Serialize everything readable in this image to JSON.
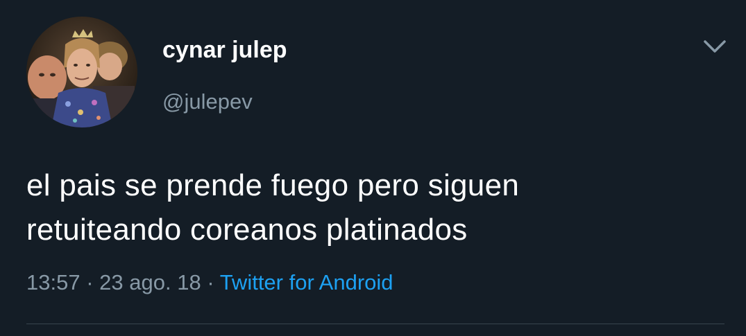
{
  "tweet": {
    "author": {
      "display_name": "cynar julep",
      "handle": "@julepev",
      "avatar_icon": "profile-photo"
    },
    "menu_icon": "chevron-down-icon",
    "text_line_1": "el pais se prende fuego pero siguen",
    "text_line_2": "retuiteando coreanos platinados",
    "time": "13:57",
    "separator": "·",
    "date": "23 ago. 18",
    "source": "Twitter for Android"
  },
  "colors": {
    "background": "#141d26",
    "text": "#ffffff",
    "muted": "#8899a6",
    "link": "#1da1f2",
    "divider": "#38444d"
  }
}
